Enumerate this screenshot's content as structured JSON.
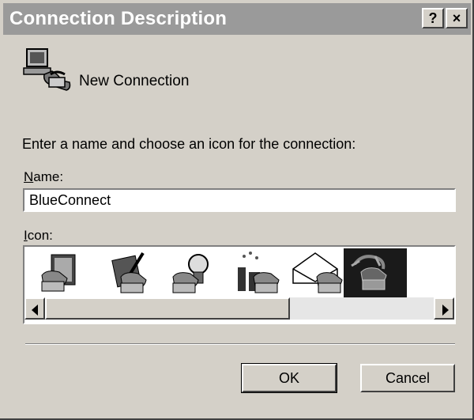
{
  "window": {
    "title": "Connection Description",
    "help_label": "?",
    "close_label": "×"
  },
  "header": {
    "label": "New Connection"
  },
  "prompt": "Enter a name and choose an icon for the connection:",
  "name_field": {
    "label_mnemonic": "N",
    "label_rest": "ame:",
    "value": "BlueConnect"
  },
  "icon_field": {
    "label_mnemonic": "I",
    "label_rest": "con:",
    "icons": [
      "phone-with-book-icon",
      "phone-with-pen-icon",
      "phone-with-lightbulb-icon",
      "phone-with-factory-icon",
      "phone-with-envelope-icon",
      "phone-with-globe-icon"
    ],
    "selected_index": 5
  },
  "buttons": {
    "ok_label": "OK",
    "cancel_label": "Cancel"
  }
}
